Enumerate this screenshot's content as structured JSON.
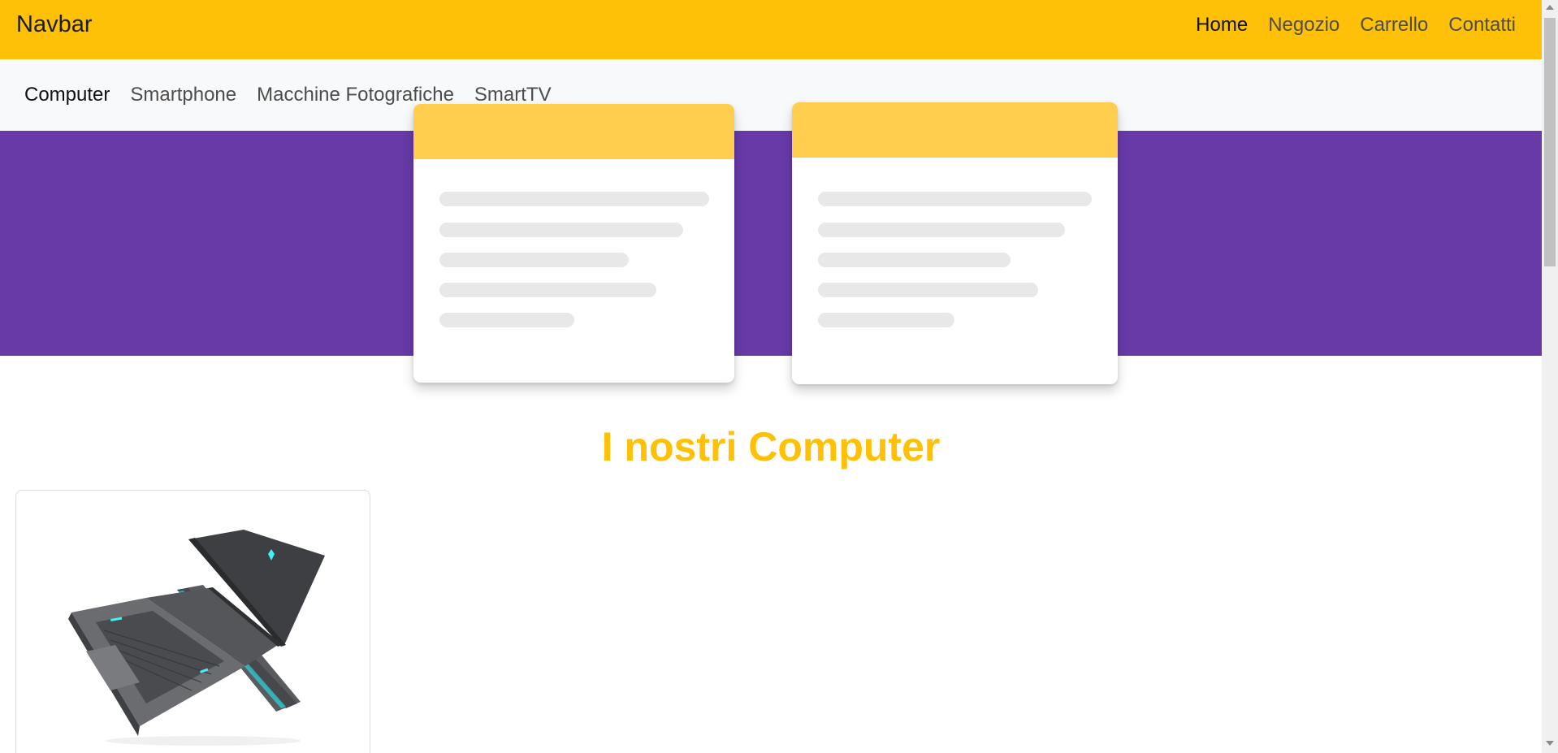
{
  "navbar": {
    "brand": "Navbar",
    "links": [
      "Home",
      "Negozio",
      "Carrello",
      "Contatti"
    ],
    "active": "Home"
  },
  "subnav": {
    "links": [
      "Computer",
      "Smartphone",
      "Macchine Fotografiche",
      "SmartTV"
    ],
    "active": "Computer"
  },
  "section": {
    "title": "I nostri Computer"
  },
  "colors": {
    "navbar_bg": "#ffc107",
    "subnav_bg": "#f8f9fa",
    "hero_bg": "#673aa8",
    "placeholder_header": "#ffce4f",
    "title_color": "#ffc107"
  },
  "icons": {
    "product_image": "laptop-icon"
  }
}
